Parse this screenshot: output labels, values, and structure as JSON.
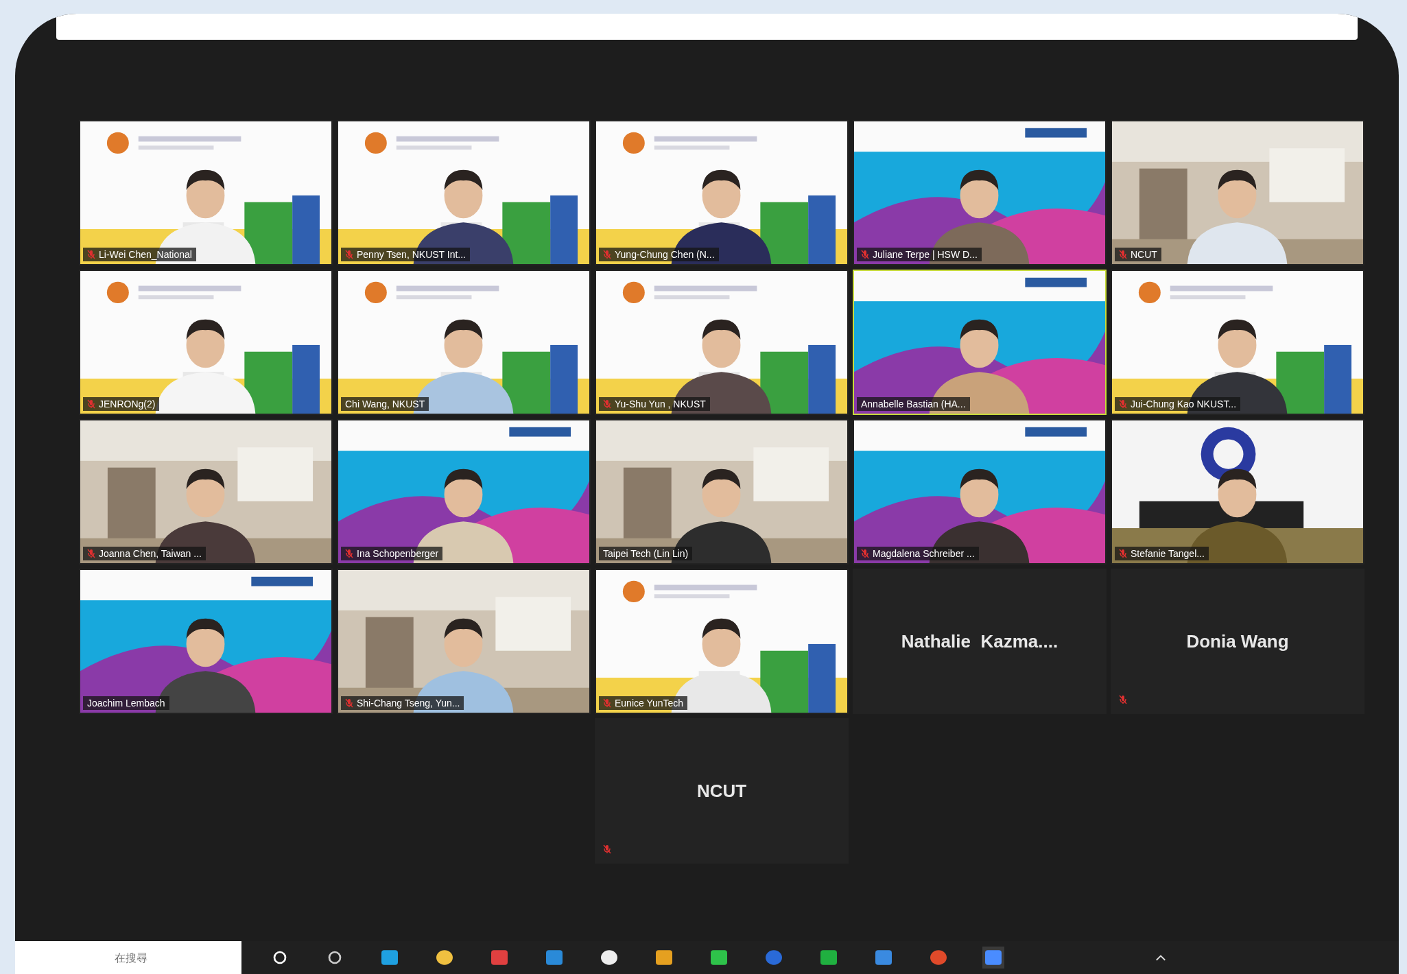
{
  "participants": [
    {
      "name": "Li-Wei Chen_National",
      "video": true,
      "muted": true,
      "speaking": false
    },
    {
      "name": "Penny Tsen, NKUST Int...",
      "video": true,
      "muted": true,
      "speaking": false
    },
    {
      "name": "Yung-Chung Chen (N...",
      "video": true,
      "muted": true,
      "speaking": false
    },
    {
      "name": "Juliane Terpe | HSW D...",
      "video": true,
      "muted": true,
      "speaking": false
    },
    {
      "name": "NCUT",
      "video": true,
      "muted": true,
      "speaking": false
    },
    {
      "name": "JENRONg(2)",
      "video": true,
      "muted": true,
      "speaking": false
    },
    {
      "name": "Chi Wang, NKUST",
      "video": true,
      "muted": false,
      "speaking": false
    },
    {
      "name": "Yu-Shu Yun , NKUST",
      "video": true,
      "muted": true,
      "speaking": false
    },
    {
      "name": "Annabelle Bastian (HA...",
      "video": true,
      "muted": false,
      "speaking": true
    },
    {
      "name": "Jui-Chung Kao NKUST...",
      "video": true,
      "muted": true,
      "speaking": false
    },
    {
      "name": "Joanna Chen, Taiwan ...",
      "video": true,
      "muted": true,
      "speaking": false
    },
    {
      "name": "Ina Schopenberger",
      "video": true,
      "muted": true,
      "speaking": false
    },
    {
      "name": "Taipei Tech (Lin Lin)",
      "video": true,
      "muted": false,
      "speaking": false
    },
    {
      "name": "Magdalena Schreiber ...",
      "video": true,
      "muted": true,
      "speaking": false
    },
    {
      "name": "Stefanie Tangel...",
      "video": true,
      "muted": true,
      "speaking": false
    },
    {
      "name": "Joachim Lembach",
      "video": true,
      "muted": false,
      "speaking": false
    },
    {
      "name": "Shi-Chang Tseng, Yun...",
      "video": true,
      "muted": true,
      "speaking": false
    },
    {
      "name": "Eunice YunTech",
      "video": true,
      "muted": true,
      "speaking": false
    },
    {
      "name": "Nathalie  Kazma....",
      "video": false,
      "muted": false,
      "speaking": false
    },
    {
      "name": "Donia Wang",
      "video": false,
      "muted": true,
      "speaking": false
    },
    {
      "name": "NCUT",
      "video": false,
      "muted": true,
      "speaking": false
    }
  ],
  "taskbar": {
    "search": {
      "placeholder": "在搜尋"
    }
  }
}
